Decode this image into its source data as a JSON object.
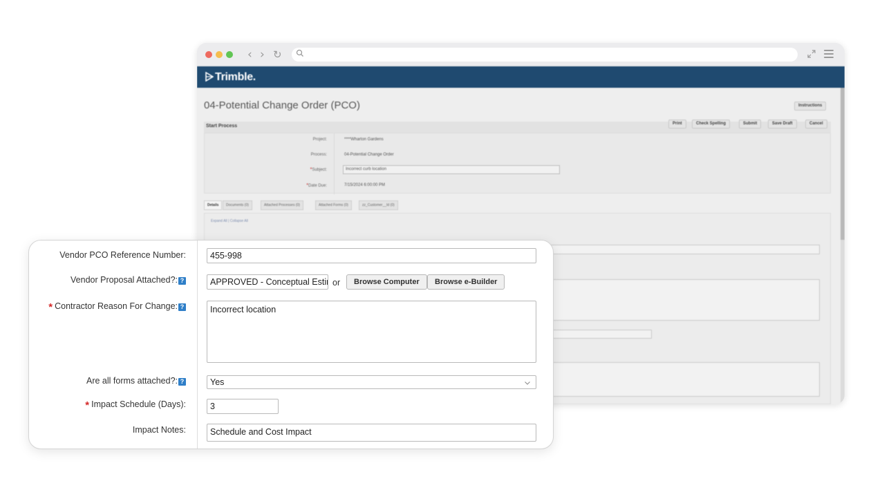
{
  "browser": {
    "nav": {
      "back": "‹",
      "forward": "›",
      "reload": "↻"
    },
    "url_placeholder": "",
    "icons": [
      "search-icon",
      "expand-icon",
      "hamburger-menu-icon",
      "back-arrow-icon",
      "forward-arrow-icon",
      "reload-icon"
    ]
  },
  "app": {
    "logo_text": "Trimble.",
    "page_title": "04-Potential Change Order (PCO)",
    "instructions_label": "Instructions",
    "section_label": "Start Process",
    "actions": [
      "Print",
      "Check Spelling",
      "Submit",
      "Save Draft",
      "Cancel"
    ],
    "form": {
      "project_label": "Project:",
      "project_value": "****Wharton Gardens",
      "process_label": "Process:",
      "process_value": "04-Potential Change Order",
      "subject_label": "Subject:",
      "subject_value": "Incorrect curb location",
      "date_label": "Date Due:",
      "date_value": "7/15/2024 6:00:00 PM"
    },
    "tabs": [
      "Details",
      "Documents (0)",
      "Attached Processes (0)",
      "Attached Forms (0)",
      "zz_Customer__Id (0)"
    ],
    "expand_link": "Expand All | Collapse All"
  },
  "card": {
    "vendor_ref_label": "Vendor PCO Reference Number:",
    "vendor_ref_value": "455-998",
    "proposal_label": "Vendor Proposal Attached?:",
    "proposal_value": "APPROVED - Conceptual Estir",
    "or_text": "or",
    "browse_computer": "Browse Computer",
    "browse_ebuilder": "Browse e-Builder",
    "reason_label": "Contractor Reason For Change:",
    "reason_value": "Incorrect location",
    "forms_label": "Are all forms attached?:",
    "forms_value": "Yes",
    "impact_schedule_label": "Impact Schedule (Days):",
    "impact_schedule_value": "3",
    "impact_notes_label": "Impact Notes:",
    "impact_notes_value": "Schedule and Cost Impact",
    "required_mark": "*",
    "help_mark": "?"
  },
  "colors": {
    "brand_bar": "#1f4a70",
    "help_icon": "#2f7fc8",
    "required": "#d42a2a",
    "traffic_red": "#ee6a5f",
    "traffic_yellow": "#f5bd4f",
    "traffic_green": "#61c554"
  }
}
